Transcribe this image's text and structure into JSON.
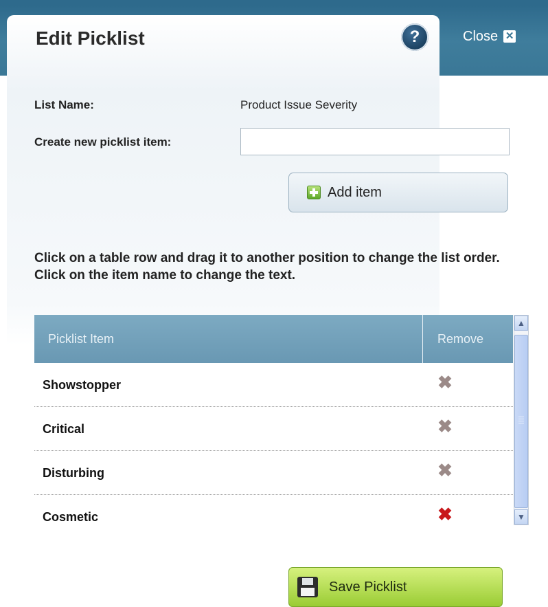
{
  "dialog": {
    "title": "Edit Picklist",
    "help_icon": "help-icon",
    "close_label": "Close",
    "close_icon": "close-icon"
  },
  "form": {
    "list_name_label": "List Name:",
    "list_name_value": "Product Issue Severity",
    "new_item_label": "Create new picklist item:",
    "new_item_value": "",
    "add_button_label": "Add item",
    "add_button_icon": "plus-icon"
  },
  "instructions": "Click on a table row and drag it to another position to change the list order. Click on the item name to change the text.",
  "table": {
    "columns": [
      "Picklist Item",
      "Remove"
    ],
    "rows": [
      {
        "label": "Showstopper",
        "remove_color": "#9b8a88"
      },
      {
        "label": "Critical",
        "remove_color": "#9b8a88"
      },
      {
        "label": "Disturbing",
        "remove_color": "#9b8a88"
      },
      {
        "label": "Cosmetic",
        "remove_color": "#c8191c"
      }
    ]
  },
  "save_button": {
    "label": "Save Picklist",
    "icon": "floppy-disk-icon"
  },
  "colors": {
    "header_band": "#3a7796",
    "table_header": "#7aa7c0",
    "save_button": "#a8d63c"
  }
}
